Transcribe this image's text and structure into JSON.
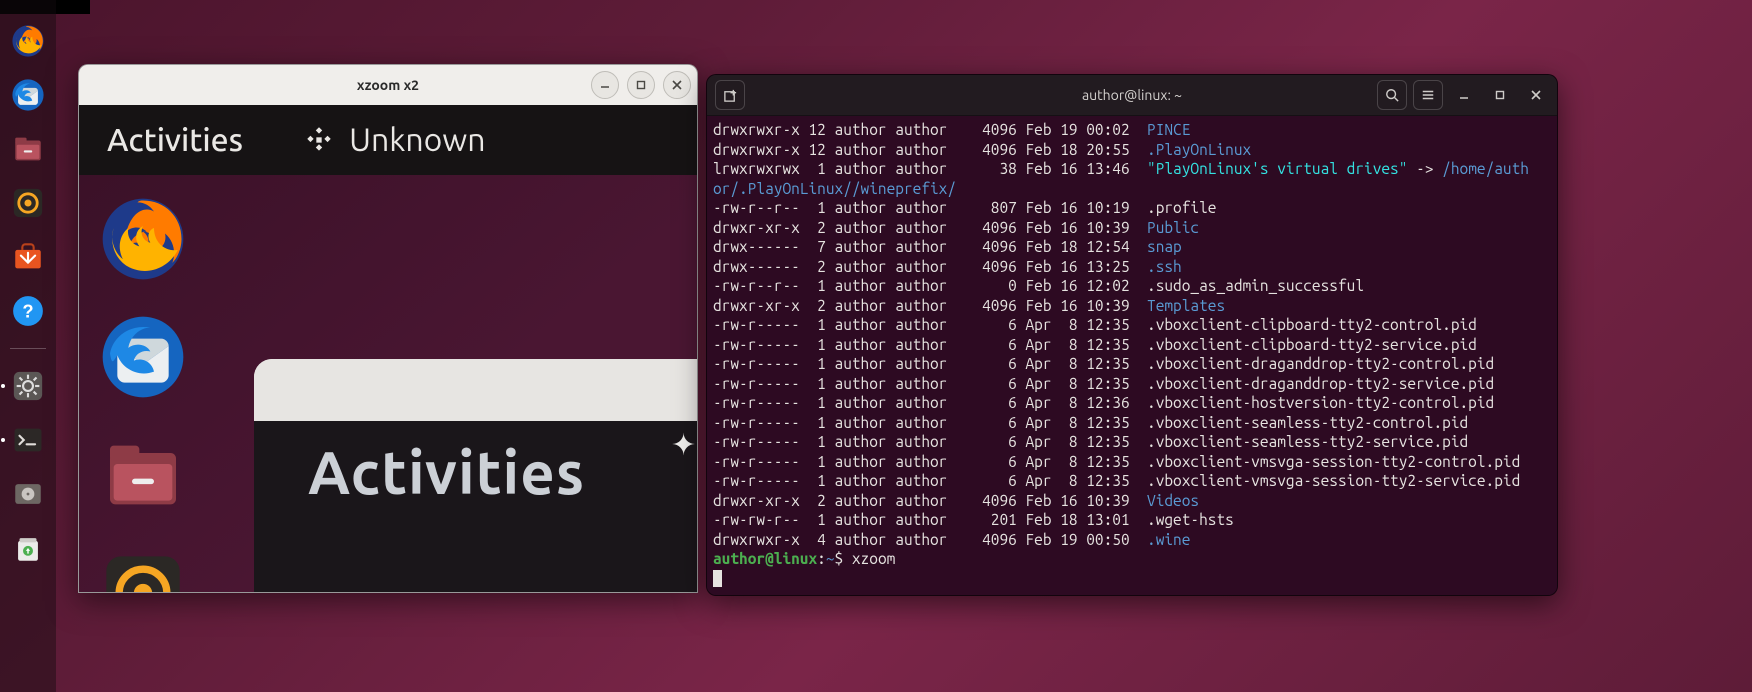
{
  "dock": {
    "items": [
      {
        "name": "firefox-icon"
      },
      {
        "name": "thunderbird-icon"
      },
      {
        "name": "files-icon"
      },
      {
        "name": "rhythmbox-icon"
      },
      {
        "name": "software-icon"
      },
      {
        "name": "help-icon"
      },
      {
        "name": "settings-icon"
      },
      {
        "name": "terminal-icon"
      },
      {
        "name": "disk-icon"
      },
      {
        "name": "trash-icon"
      }
    ]
  },
  "xzoom": {
    "title": "xzoom x2",
    "topbar": {
      "activities": "Activities",
      "unknown": "Unknown"
    },
    "subwindow": {
      "label": "Activities"
    }
  },
  "terminal": {
    "title": "author@linux: ~",
    "prompt": {
      "userhost": "author@linux",
      "path": "~",
      "command": "xzoom"
    },
    "symlink": {
      "name": "\"PlayOnLinux's virtual drives\"",
      "arrow": "->",
      "target_prefix": "/home/auth",
      "target_wrap": "or/.PlayOnLinux//wineprefix/"
    },
    "rows": [
      {
        "perm": "drwxrwxr-x",
        "links": "12",
        "owner": "author",
        "group": "author",
        "size": "4096",
        "date": "Feb 19 00:02",
        "name": "PINCE",
        "cls": "c-blue"
      },
      {
        "perm": "drwxrwxr-x",
        "links": "12",
        "owner": "author",
        "group": "author",
        "size": "4096",
        "date": "Feb 18 20:55",
        "name": ".PlayOnLinux",
        "cls": "c-blue"
      },
      {
        "perm": "lrwxrwxrwx",
        "links": "1",
        "owner": "author",
        "group": "author",
        "size": "38",
        "date": "Feb 16 13:46",
        "name": "",
        "cls": "c-cyan",
        "symlink": true
      },
      {
        "perm": "-rw-r--r--",
        "links": "1",
        "owner": "author",
        "group": "author",
        "size": "807",
        "date": "Feb 16 10:19",
        "name": ".profile",
        "cls": "c-white"
      },
      {
        "perm": "drwxr-xr-x",
        "links": "2",
        "owner": "author",
        "group": "author",
        "size": "4096",
        "date": "Feb 16 10:39",
        "name": "Public",
        "cls": "c-blue"
      },
      {
        "perm": "drwx------",
        "links": "7",
        "owner": "author",
        "group": "author",
        "size": "4096",
        "date": "Feb 18 12:54",
        "name": "snap",
        "cls": "c-blue"
      },
      {
        "perm": "drwx------",
        "links": "2",
        "owner": "author",
        "group": "author",
        "size": "4096",
        "date": "Feb 16 13:25",
        "name": ".ssh",
        "cls": "c-blue"
      },
      {
        "perm": "-rw-r--r--",
        "links": "1",
        "owner": "author",
        "group": "author",
        "size": "0",
        "date": "Feb 16 12:02",
        "name": ".sudo_as_admin_successful",
        "cls": "c-white"
      },
      {
        "perm": "drwxr-xr-x",
        "links": "2",
        "owner": "author",
        "group": "author",
        "size": "4096",
        "date": "Feb 16 10:39",
        "name": "Templates",
        "cls": "c-blue"
      },
      {
        "perm": "-rw-r-----",
        "links": "1",
        "owner": "author",
        "group": "author",
        "size": "6",
        "date": "Apr  8 12:35",
        "name": ".vboxclient-clipboard-tty2-control.pid",
        "cls": "c-white"
      },
      {
        "perm": "-rw-r-----",
        "links": "1",
        "owner": "author",
        "group": "author",
        "size": "6",
        "date": "Apr  8 12:35",
        "name": ".vboxclient-clipboard-tty2-service.pid",
        "cls": "c-white"
      },
      {
        "perm": "-rw-r-----",
        "links": "1",
        "owner": "author",
        "group": "author",
        "size": "6",
        "date": "Apr  8 12:35",
        "name": ".vboxclient-draganddrop-tty2-control.pid",
        "cls": "c-white"
      },
      {
        "perm": "-rw-r-----",
        "links": "1",
        "owner": "author",
        "group": "author",
        "size": "6",
        "date": "Apr  8 12:35",
        "name": ".vboxclient-draganddrop-tty2-service.pid",
        "cls": "c-white"
      },
      {
        "perm": "-rw-r-----",
        "links": "1",
        "owner": "author",
        "group": "author",
        "size": "6",
        "date": "Apr  8 12:36",
        "name": ".vboxclient-hostversion-tty2-control.pid",
        "cls": "c-white"
      },
      {
        "perm": "-rw-r-----",
        "links": "1",
        "owner": "author",
        "group": "author",
        "size": "6",
        "date": "Apr  8 12:35",
        "name": ".vboxclient-seamless-tty2-control.pid",
        "cls": "c-white"
      },
      {
        "perm": "-rw-r-----",
        "links": "1",
        "owner": "author",
        "group": "author",
        "size": "6",
        "date": "Apr  8 12:35",
        "name": ".vboxclient-seamless-tty2-service.pid",
        "cls": "c-white"
      },
      {
        "perm": "-rw-r-----",
        "links": "1",
        "owner": "author",
        "group": "author",
        "size": "6",
        "date": "Apr  8 12:35",
        "name": ".vboxclient-vmsvga-session-tty2-control.pid",
        "cls": "c-white"
      },
      {
        "perm": "-rw-r-----",
        "links": "1",
        "owner": "author",
        "group": "author",
        "size": "6",
        "date": "Apr  8 12:35",
        "name": ".vboxclient-vmsvga-session-tty2-service.pid",
        "cls": "c-white"
      },
      {
        "perm": "drwxr-xr-x",
        "links": "2",
        "owner": "author",
        "group": "author",
        "size": "4096",
        "date": "Feb 16 10:39",
        "name": "Videos",
        "cls": "c-blue"
      },
      {
        "perm": "-rw-rw-r--",
        "links": "1",
        "owner": "author",
        "group": "author",
        "size": "201",
        "date": "Feb 18 13:01",
        "name": ".wget-hsts",
        "cls": "c-white"
      },
      {
        "perm": "drwxrwxr-x",
        "links": "4",
        "owner": "author",
        "group": "author",
        "size": "4096",
        "date": "Feb 19 00:50",
        "name": ".wine",
        "cls": "c-blue"
      }
    ]
  }
}
